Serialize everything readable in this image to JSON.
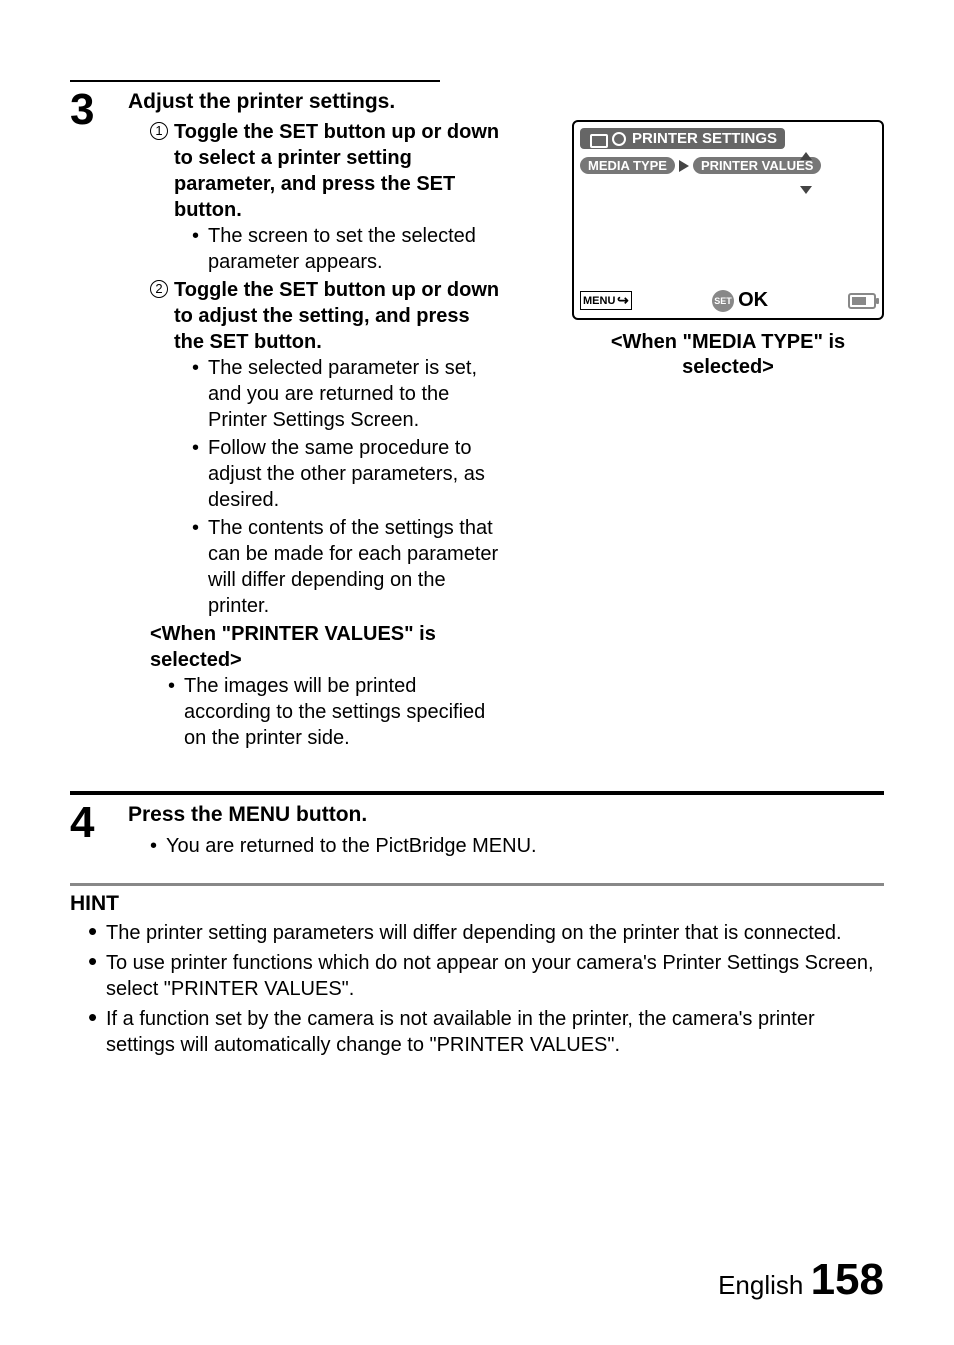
{
  "step3": {
    "number": "3",
    "title": "Adjust the printer settings.",
    "sub1_num": "1",
    "sub1_title": "Toggle the SET button up or down to select a printer setting parameter, and press the SET button.",
    "sub1_bullet1": "The screen to set the selected parameter appears.",
    "sub2_num": "2",
    "sub2_title": "Toggle the SET button up or down to adjust the setting, and press the SET button.",
    "sub2_bullet1": "The selected parameter is set, and you are returned to the Printer Settings Screen.",
    "sub2_bullet2": "Follow the same procedure to adjust the other parameters, as desired.",
    "sub2_bullet3": "The contents of the settings that can be made for each parameter will differ depending on the printer.",
    "pv_heading": "<When \"PRINTER VALUES\" is selected>",
    "pv_bullet": "The images will be printed according to the settings specified on the printer side."
  },
  "step4": {
    "number": "4",
    "title": "Press the MENU button.",
    "bullet1": "You are returned to the PictBridge MENU."
  },
  "hint": {
    "label": "HINT",
    "item1": "The printer setting parameters will differ depending on the printer that is connected.",
    "item2": "To use printer functions which do not appear on your camera's Printer Settings Screen, select \"PRINTER VALUES\".",
    "item3": "If a function set by the camera is not available in the printer, the camera's printer settings will automatically change to \"PRINTER VALUES\"."
  },
  "screen": {
    "header": "PRINTER SETTINGS",
    "left_pill": "MEDIA TYPE",
    "right_pill": "PRINTER VALUES",
    "menu_label": "MENU",
    "set_label": "SET",
    "ok_label": "OK",
    "caption": "<When \"MEDIA TYPE\" is selected>"
  },
  "footer": {
    "lang": "English",
    "page": "158"
  }
}
